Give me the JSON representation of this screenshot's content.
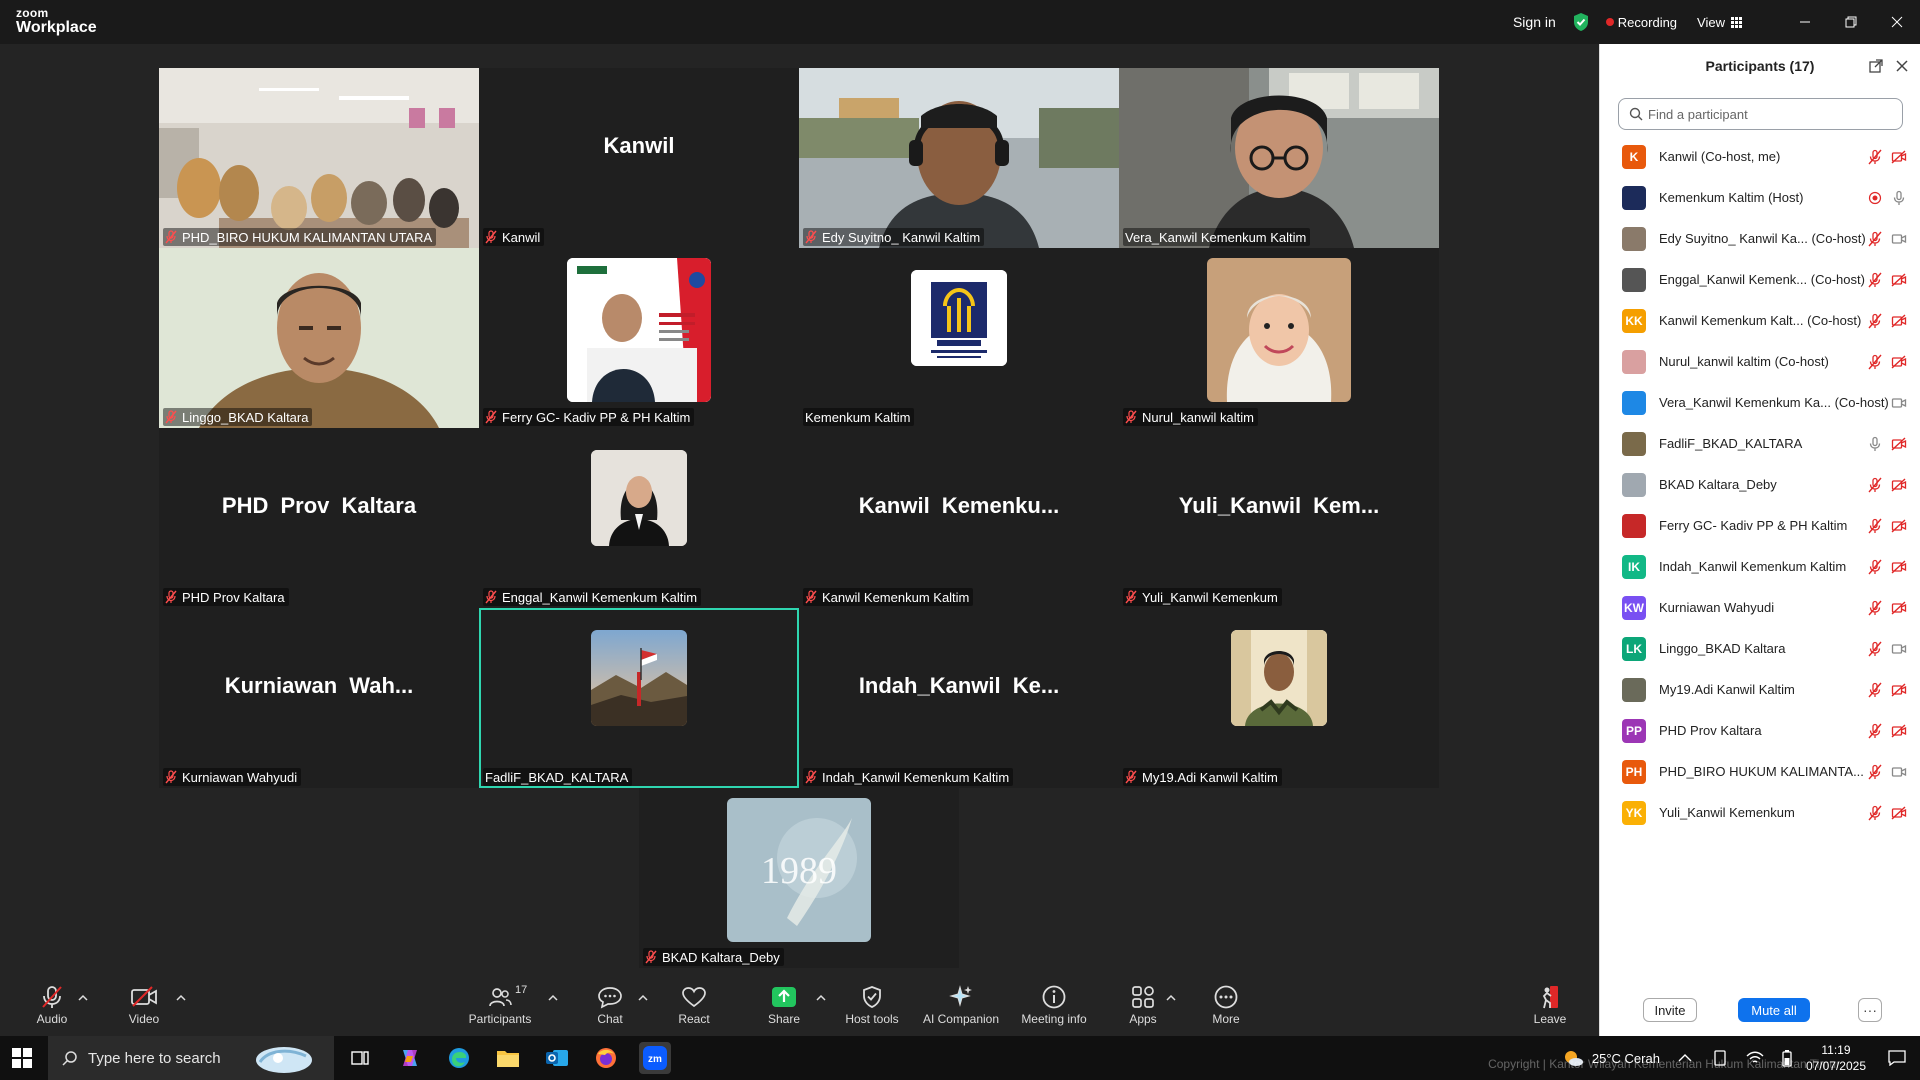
{
  "titlebar": {
    "logo_top": "zoom",
    "logo_bottom": "Workplace",
    "sign_in": "Sign in",
    "recording": "Recording",
    "view": "View"
  },
  "tiles": [
    {
      "label": "PHD_BIRO HUKUM KALIMANTAN UTARA",
      "big": "",
      "kind": "video-office"
    },
    {
      "label": "Kanwil",
      "big": "Kanwil",
      "kind": "name"
    },
    {
      "label": "Edy Suyitno_ Kanwil Kaltim",
      "big": "",
      "kind": "video-man"
    },
    {
      "label": "Vera_Kanwil Kemenkum Kaltim",
      "big": "",
      "kind": "video-woman"
    },
    {
      "label": "Linggo_BKAD Kaltara",
      "big": "",
      "kind": "video-linggo"
    },
    {
      "label": "Ferry GC- Kadiv PP & PH Kaltim",
      "big": "",
      "kind": "avatar-ferry"
    },
    {
      "label": "Kemenkum Kaltim",
      "big": "",
      "kind": "avatar-logo"
    },
    {
      "label": "Nurul_kanwil kaltim",
      "big": "",
      "kind": "avatar-nurul"
    },
    {
      "label": "PHD Prov Kaltara",
      "big": "PHD Prov Kaltara",
      "kind": "name"
    },
    {
      "label": "Enggal_Kanwil Kemenkum Kaltim",
      "big": "",
      "kind": "avatar-enggal"
    },
    {
      "label": "Kanwil Kemenkum Kaltim",
      "big": "Kanwil  Kemenku...",
      "kind": "name"
    },
    {
      "label": "Yuli_Kanwil Kemenkum",
      "big": "Yuli_Kanwil  Kem...",
      "kind": "name"
    },
    {
      "label": "Kurniawan Wahyudi",
      "big": "Kurniawan  Wah...",
      "kind": "name"
    },
    {
      "label": "FadliF_BKAD_KALTARA",
      "big": "",
      "kind": "avatar-mountain"
    },
    {
      "label": "Indah_Kanwil Kemenkum Kaltim",
      "big": "Indah_Kanwil  Ke...",
      "kind": "name"
    },
    {
      "label": "My19.Adi Kanwil Kaltim",
      "big": "",
      "kind": "avatar-adi"
    },
    {
      "label": "BKAD Kaltara_Deby",
      "big": "",
      "kind": "avatar-1989"
    }
  ],
  "tile_1989_text": "1989",
  "panel": {
    "title": "Participants (17)",
    "search_placeholder": "Find a participant",
    "invite": "Invite",
    "mute_all": "Mute all",
    "more": "···",
    "participants": [
      {
        "name": "Kanwil (Co-host, me)",
        "initials": "K",
        "color": "#e8590c",
        "mic": "muted",
        "cam": "off"
      },
      {
        "name": "Kemenkum Kaltim (Host)",
        "initials": "",
        "color": "#1c2b5a",
        "mic": "rec",
        "cam": "mic-on"
      },
      {
        "name": "Edy Suyitno_ Kanwil Ka... (Co-host)",
        "initials": "",
        "color": "#8a7a6a",
        "mic": "muted",
        "cam": "on"
      },
      {
        "name": "Enggal_Kanwil Kemenk... (Co-host)",
        "initials": "",
        "color": "#555555",
        "mic": "muted",
        "cam": "off"
      },
      {
        "name": "Kanwil Kemenkum Kalt... (Co-host)",
        "initials": "KK",
        "color": "#f59f00",
        "mic": "muted",
        "cam": "off"
      },
      {
        "name": "Nurul_kanwil kaltim (Co-host)",
        "initials": "",
        "color": "#d9a0a0",
        "mic": "muted",
        "cam": "off"
      },
      {
        "name": "Vera_Kanwil Kemenkum Ka... (Co-host)",
        "initials": "",
        "color": "#1e88e5",
        "mic": "none",
        "cam": "on"
      },
      {
        "name": "FadliF_BKAD_KALTARA",
        "initials": "",
        "color": "#7a6a4a",
        "mic": "mic-on",
        "cam": "off"
      },
      {
        "name": "BKAD Kaltara_Deby",
        "initials": "",
        "color": "#a0a8b0",
        "mic": "muted",
        "cam": "off"
      },
      {
        "name": "Ferry GC- Kadiv PP & PH Kaltim",
        "initials": "",
        "color": "#c62828",
        "mic": "muted",
        "cam": "off"
      },
      {
        "name": "Indah_Kanwil Kemenkum Kaltim",
        "initials": "IK",
        "color": "#12b886",
        "mic": "muted",
        "cam": "off"
      },
      {
        "name": "Kurniawan Wahyudi",
        "initials": "KW",
        "color": "#7950f2",
        "mic": "muted",
        "cam": "off"
      },
      {
        "name": "Linggo_BKAD Kaltara",
        "initials": "LK",
        "color": "#0ca678",
        "mic": "muted",
        "cam": "on"
      },
      {
        "name": "My19.Adi Kanwil Kaltim",
        "initials": "",
        "color": "#6a6a5a",
        "mic": "muted",
        "cam": "off"
      },
      {
        "name": "PHD Prov Kaltara",
        "initials": "PP",
        "color": "#9c36b5",
        "mic": "muted",
        "cam": "off"
      },
      {
        "name": "PHD_BIRO HUKUM KALIMANTA...",
        "initials": "PH",
        "color": "#e8590c",
        "mic": "muted",
        "cam": "on"
      },
      {
        "name": "Yuli_Kanwil Kemenkum",
        "initials": "YK",
        "color": "#fab005",
        "mic": "muted",
        "cam": "off"
      }
    ]
  },
  "toolbar": {
    "audio": "Audio",
    "video": "Video",
    "participants": "Participants",
    "participants_count": "17",
    "chat": "Chat",
    "react": "React",
    "share": "Share",
    "host_tools": "Host tools",
    "ai_companion": "AI Companion",
    "meeting_info": "Meeting info",
    "apps": "Apps",
    "more": "More",
    "leave": "Leave"
  },
  "taskbar": {
    "search_placeholder": "Type here to search",
    "weather": "25°C  Cerah",
    "time": "11:19",
    "date": "07/07/2025",
    "watermark": "Copyright | Kantor Wilayah Kementerian Hukum Kalimantan Timur"
  },
  "colors": {
    "accent": "#0e72ed",
    "active_speaker": "#2fd6b0",
    "muted_red": "#e02828",
    "share_green": "#22c55e"
  }
}
